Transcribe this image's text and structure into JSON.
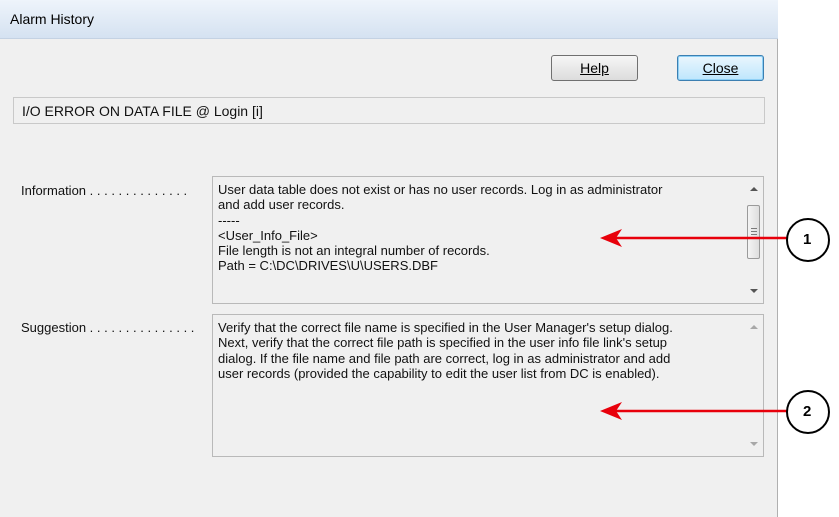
{
  "window": {
    "title": "Alarm History"
  },
  "buttons": {
    "help": "Help",
    "close": "Close"
  },
  "error_message": "I/O ERROR ON DATA FILE @ Login  [i]",
  "information": {
    "label": "Information . . . . . . . . . . . . . .",
    "lines": [
      "User data table does not exist or has no user records. Log in as administrator",
      "and add user records.",
      "-----",
      "<User_Info_File>",
      "File length is not an integral number of records.",
      "Path = C:\\DC\\DRIVES\\U\\USERS.DBF"
    ]
  },
  "suggestion": {
    "label": "Suggestion . . . . . . . . . . . . . . .",
    "lines": [
      "Verify that the correct file name is specified in the User Manager's setup dialog.",
      "Next, verify that the correct file path is specified in the user info file link's setup",
      "dialog. If the file name and file path are correct, log in as administrator and add",
      "user records (provided the capability to edit the user list from DC is enabled)."
    ]
  },
  "callouts": [
    {
      "number": "1"
    },
    {
      "number": "2"
    }
  ],
  "colors": {
    "arrow": "#e8000b",
    "accent": "#3c7fb1"
  }
}
